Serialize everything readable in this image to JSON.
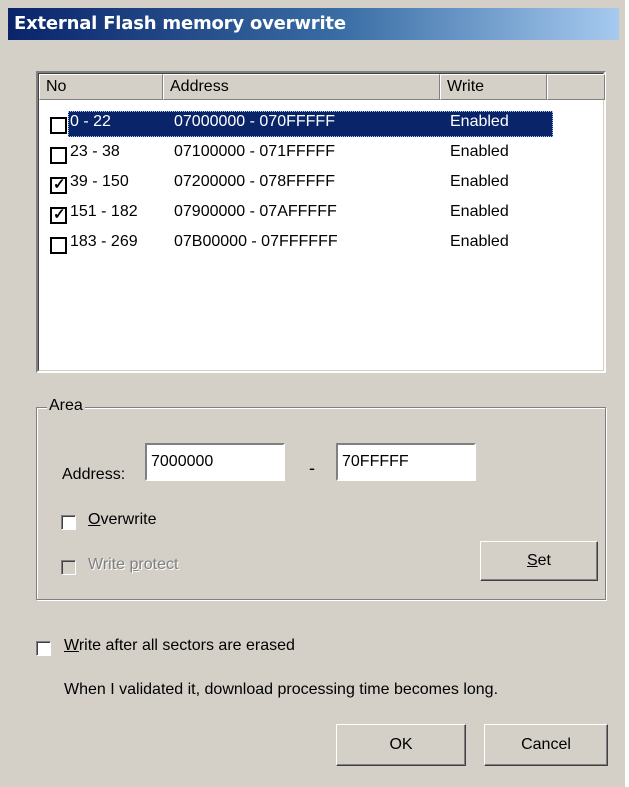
{
  "window": {
    "title": "External Flash memory overwrite"
  },
  "list": {
    "columns": {
      "no": "No",
      "address": "Address",
      "write": "Write"
    },
    "rows": [
      {
        "no": "0 - 22",
        "address": "07000000 - 070FFFFF",
        "write": "Enabled",
        "checked": false,
        "selected": true
      },
      {
        "no": "23 - 38",
        "address": "07100000 - 071FFFFF",
        "write": "Enabled",
        "checked": false,
        "selected": false
      },
      {
        "no": "39 - 150",
        "address": "07200000 - 078FFFFF",
        "write": "Enabled",
        "checked": true,
        "selected": false
      },
      {
        "no": "151 - 182",
        "address": "07900000 - 07AFFFFF",
        "write": "Enabled",
        "checked": true,
        "selected": false
      },
      {
        "no": "183 - 269",
        "address": "07B00000 - 07FFFFFF",
        "write": "Enabled",
        "checked": false,
        "selected": false
      }
    ]
  },
  "area": {
    "legend": "Area",
    "address_label": "Address:",
    "start_value": "7000000",
    "separator": "-",
    "end_value": "70FFFFF",
    "overwrite_label_first": "O",
    "overwrite_label_rest": "verwrite",
    "overwrite_checked": false,
    "write_protect_label_pre": "Write ",
    "write_protect_label_u": "p",
    "write_protect_label_post": "rotect",
    "write_protect_enabled": false,
    "set_label_u": "S",
    "set_label_rest": "et"
  },
  "options": {
    "write_after_label_u": "W",
    "write_after_label_rest": "rite after all sectors are erased",
    "write_after_checked": false,
    "note": "When I validated it, download processing time becomes long."
  },
  "buttons": {
    "ok": "OK",
    "cancel": "Cancel"
  }
}
